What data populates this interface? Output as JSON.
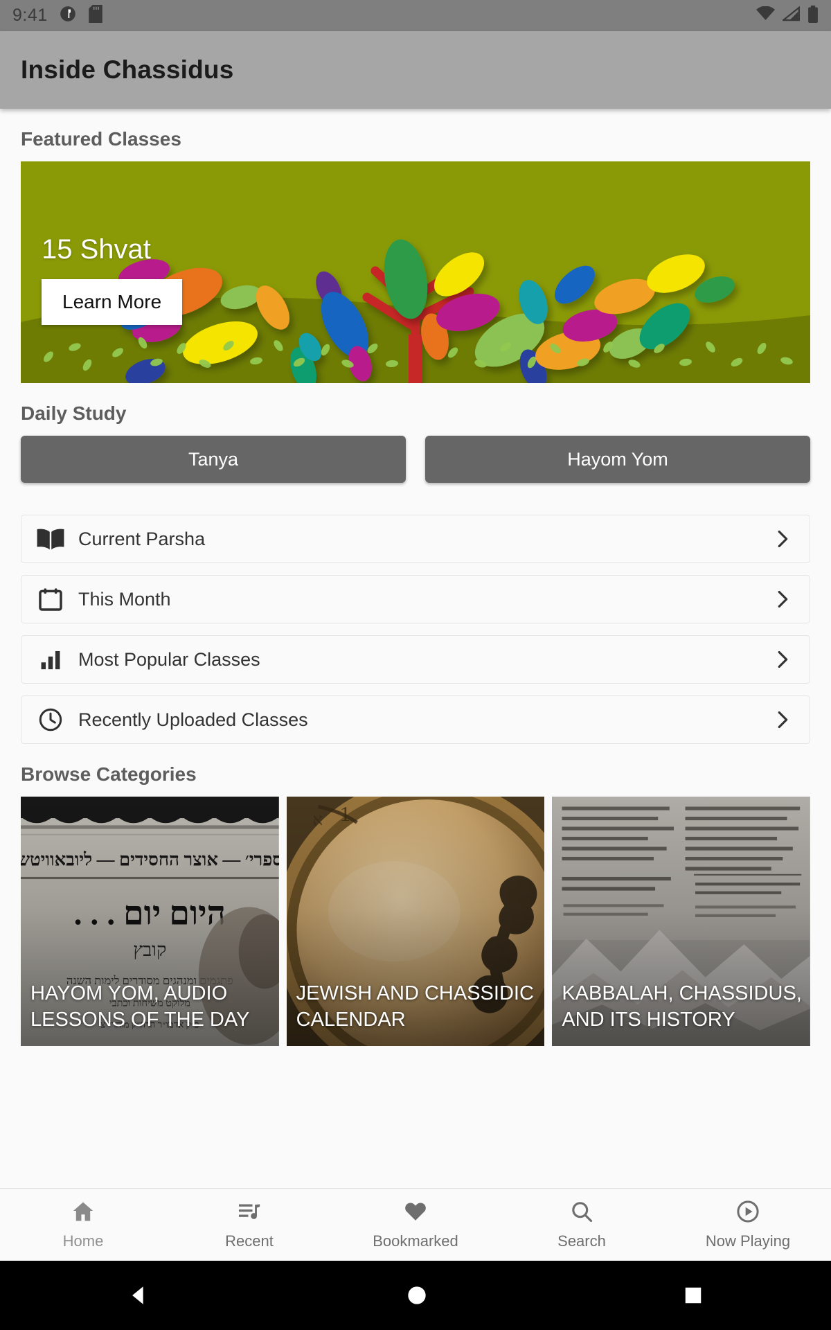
{
  "status_bar": {
    "time": "9:41",
    "left_icons": [
      "app-notification-icon",
      "sd-card-icon"
    ],
    "right_icons": [
      "wifi-icon",
      "cell-signal-icon",
      "battery-icon"
    ],
    "background_color": "#7f7f7f"
  },
  "app_bar": {
    "title": "Inside Chassidus",
    "background_color": "#a6a6a6"
  },
  "featured": {
    "section_title": "Featured Classes",
    "banner": {
      "label": "15 Shvat",
      "button_label": "Learn More",
      "background_color": "#8a9a06",
      "ground_color": "#6e7c04",
      "trunk_color": "#c62828",
      "leaf_colors": [
        "#f5e400",
        "#f0a020",
        "#e8731c",
        "#1565c0",
        "#2b3f9e",
        "#0e9d6e",
        "#2e9b4a",
        "#8cc152",
        "#16a0ab",
        "#b81e8c",
        "#5e2d91"
      ]
    }
  },
  "daily_study": {
    "section_title": "Daily Study",
    "buttons": [
      {
        "label": "Tanya"
      },
      {
        "label": "Hayom Yom"
      }
    ],
    "button_color": "#666666"
  },
  "quick_links": [
    {
      "label": "Current Parsha",
      "icon": "book-icon"
    },
    {
      "label": "This Month",
      "icon": "calendar-icon"
    },
    {
      "label": "Most Popular Classes",
      "icon": "bar-chart-icon"
    },
    {
      "label": "Recently Uploaded Classes",
      "icon": "clock-icon"
    }
  ],
  "browse": {
    "section_title": "Browse Categories",
    "cards": [
      {
        "title": "HAYOM YOM, AUDIO LESSONS OF THE DAY",
        "image": "hayom-yom-book-cover"
      },
      {
        "title": "JEWISH AND CHASSIDIC CALENDAR",
        "image": "antique-pocket-watch"
      },
      {
        "title": "KABBALAH, CHASSIDUS, AND ITS HISTORY",
        "image": "hebrew-manuscript-stones"
      }
    ]
  },
  "bottom_nav": {
    "items": [
      {
        "label": "Home",
        "icon": "home-icon",
        "active": true
      },
      {
        "label": "Recent",
        "icon": "queue-music-icon",
        "active": false
      },
      {
        "label": "Bookmarked",
        "icon": "heart-icon",
        "active": false
      },
      {
        "label": "Search",
        "icon": "search-icon",
        "active": false
      },
      {
        "label": "Now Playing",
        "icon": "play-circle-icon",
        "active": false
      }
    ]
  },
  "system_nav": {
    "buttons": [
      {
        "icon": "back-triangle-icon"
      },
      {
        "icon": "home-circle-icon"
      },
      {
        "icon": "recents-square-icon"
      }
    ]
  }
}
